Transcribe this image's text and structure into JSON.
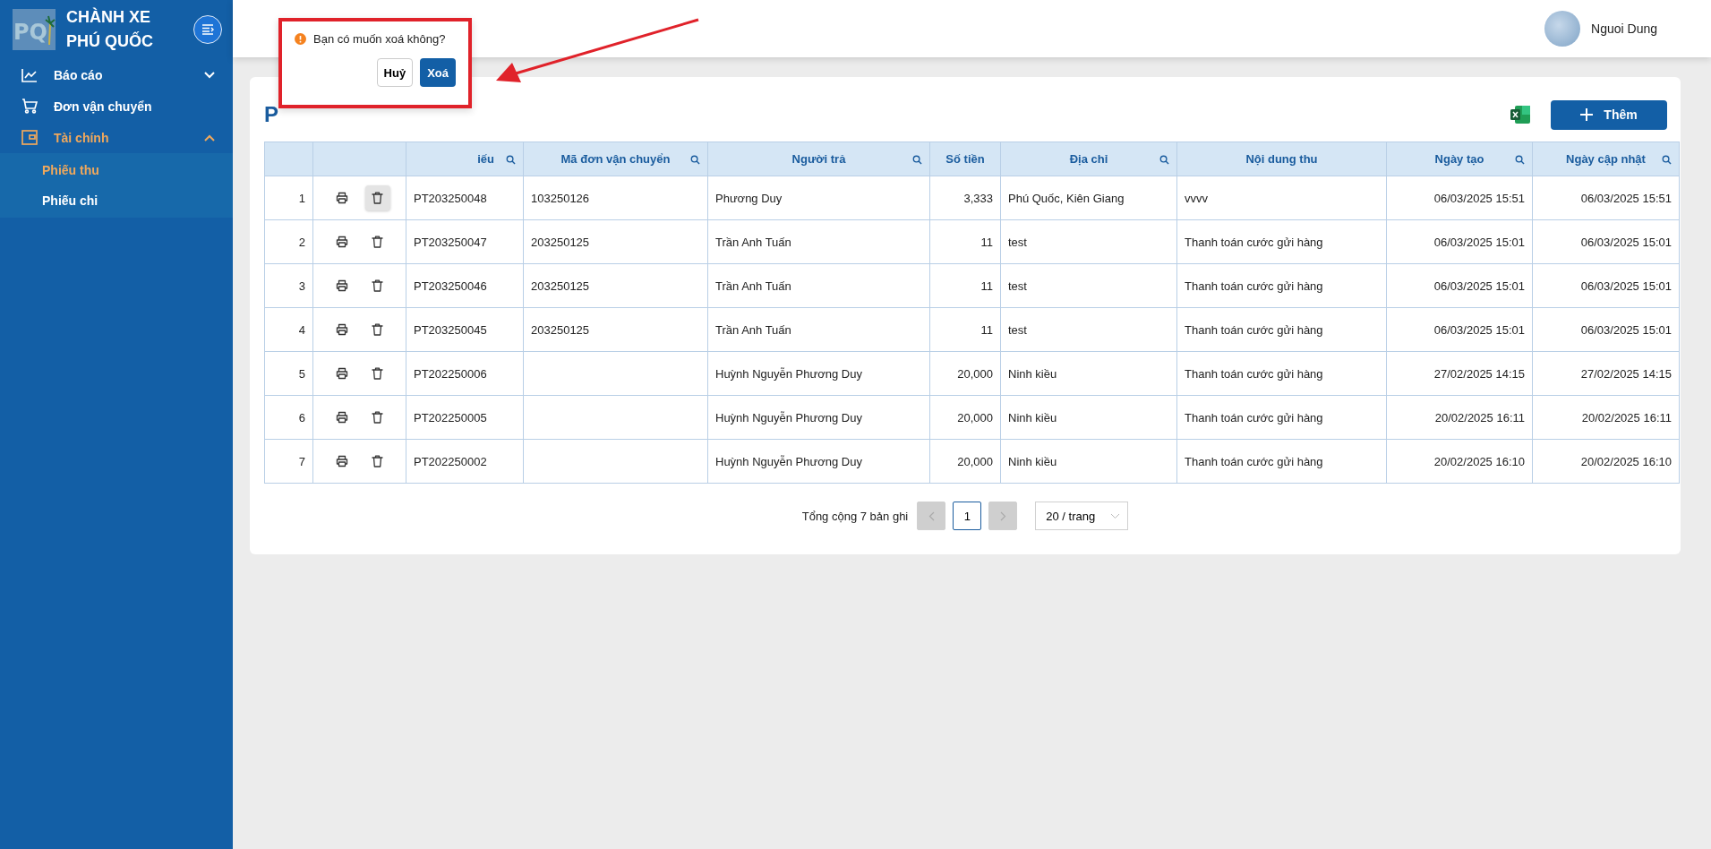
{
  "sidebar": {
    "logo": "PQ",
    "brand": "CHÀNH XE PHÚ QUỐC",
    "items": [
      {
        "label": "Báo cáo",
        "expanded": false,
        "selected": false
      },
      {
        "label": "Đơn vận chuyển",
        "selected": false
      },
      {
        "label": "Tài chính",
        "expanded": true,
        "selected": true,
        "children": [
          {
            "label": "Phiếu thu",
            "selected": true
          },
          {
            "label": "Phiếu chi",
            "selected": false
          }
        ]
      }
    ]
  },
  "header": {
    "user": "Nguoi Dung"
  },
  "page": {
    "title": "P",
    "add_button": "Thêm"
  },
  "table": {
    "columns": [
      {
        "searchable": false
      },
      {
        "searchable": false
      },
      {
        "label": "iếu",
        "searchable": true
      },
      {
        "label": "Mã đơn vận chuyển",
        "searchable": true
      },
      {
        "label": "Người trả",
        "searchable": true
      },
      {
        "label": "Số tiền",
        "searchable": false
      },
      {
        "label": "Địa chỉ",
        "searchable": true
      },
      {
        "label": "Nội dung thu",
        "searchable": false
      },
      {
        "label": "Ngày tạo",
        "searchable": true
      },
      {
        "label": "Ngày cập nhật",
        "searchable": true
      }
    ],
    "rows": [
      {
        "no": "1",
        "delete_active": true,
        "code": "PT203250048",
        "order": "103250126",
        "payer": "Phương Duy",
        "amount": "3,333",
        "address": "Phú Quốc, Kiên Giang",
        "content": "vvvv",
        "created": "06/03/2025 15:51",
        "updated": "06/03/2025 15:51"
      },
      {
        "no": "2",
        "delete_active": false,
        "code": "PT203250047",
        "order": "203250125",
        "payer": "Trần Anh Tuấn",
        "amount": "11",
        "address": "test",
        "content": "Thanh toán cước gửi hàng",
        "created": "06/03/2025 15:01",
        "updated": "06/03/2025 15:01"
      },
      {
        "no": "3",
        "delete_active": false,
        "code": "PT203250046",
        "order": "203250125",
        "payer": "Trần Anh Tuấn",
        "amount": "11",
        "address": "test",
        "content": "Thanh toán cước gửi hàng",
        "created": "06/03/2025 15:01",
        "updated": "06/03/2025 15:01"
      },
      {
        "no": "4",
        "delete_active": false,
        "code": "PT203250045",
        "order": "203250125",
        "payer": "Trần Anh Tuấn",
        "amount": "11",
        "address": "test",
        "content": "Thanh toán cước gửi hàng",
        "created": "06/03/2025 15:01",
        "updated": "06/03/2025 15:01"
      },
      {
        "no": "5",
        "delete_active": false,
        "code": "PT202250006",
        "payer": "Huỳnh Nguyễn Phương Duy",
        "amount": "20,000",
        "address": "Ninh kiều",
        "content": "Thanh toán cước gửi hàng",
        "created": "27/02/2025 14:15",
        "updated": "27/02/2025 14:15"
      },
      {
        "no": "6",
        "delete_active": false,
        "code": "PT202250005",
        "payer": "Huỳnh Nguyễn Phương Duy",
        "amount": "20,000",
        "address": "Ninh kiều",
        "content": "Thanh toán cước gửi hàng",
        "created": "20/02/2025 16:11",
        "updated": "20/02/2025 16:11"
      },
      {
        "no": "7",
        "delete_active": false,
        "code": "PT202250002",
        "payer": "Huỳnh Nguyễn Phương Duy",
        "amount": "20,000",
        "address": "Ninh kiều",
        "content": "Thanh toán cước gửi hàng",
        "created": "20/02/2025 16:10",
        "updated": "20/02/2025 16:10"
      }
    ]
  },
  "pagination": {
    "total": "Tổng cộng 7 bản ghi",
    "pages": [
      {
        "label": "1",
        "selected": true
      }
    ],
    "prev_disabled": true,
    "next_disabled": true,
    "page_size": "20 / trang"
  },
  "popconfirm": {
    "message": "Bạn có muốn xoá không?",
    "cancel": "Huỷ",
    "confirm": "Xoá"
  }
}
